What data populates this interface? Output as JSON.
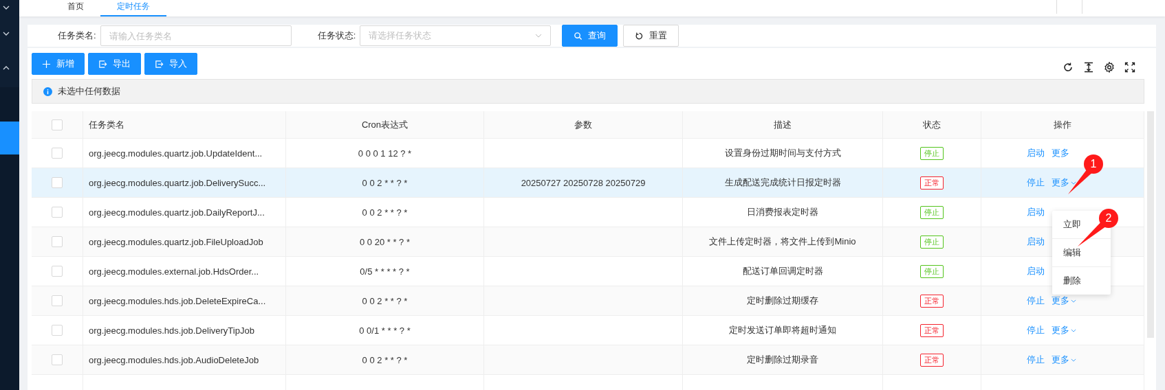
{
  "tabs": [
    {
      "label": "首页",
      "selected": false
    },
    {
      "label": "定时任务",
      "selected": true
    }
  ],
  "search": {
    "fields": [
      {
        "label": "任务类名:",
        "placeholder": "请输入任务类名",
        "kind": "input"
      },
      {
        "label": "任务状态:",
        "placeholder": "请选择任务状态",
        "kind": "select"
      }
    ],
    "buttons": [
      {
        "label": "查询",
        "kind": "primary"
      },
      {
        "label": "重置",
        "kind": "default"
      }
    ]
  },
  "toolbar": {
    "buttons": [
      {
        "label": "新增",
        "kind": "add"
      },
      {
        "label": "导出",
        "kind": "export"
      },
      {
        "label": "导入",
        "kind": "import"
      }
    ]
  },
  "alert": "未选中任何数据",
  "table": {
    "select_all_checked": false,
    "columns": [
      "任务类名",
      "Cron表达式",
      "参数",
      "描述",
      "状态",
      "操作"
    ],
    "rows": [
      {
        "name": "org.jeecg.modules.quartz.job.UpdateIdent...",
        "cron": "0 0 0 1 12 ? *",
        "param": "",
        "desc": "设置身份过期时间与支付方式",
        "status": "停止",
        "color": "#52c41a",
        "action": "启动",
        "more": "更多",
        "more_caret": false,
        "selected": false
      },
      {
        "name": "org.jeecg.modules.quartz.job.DeliverySucc...",
        "cron": "0 0 2 * * ? *",
        "param": "20250727 20250728 20250729",
        "desc": "生成配送完成统计日报定时器",
        "status": "正常",
        "color": "#f5222d",
        "action": "停止",
        "more": "更多",
        "more_caret": true,
        "selected": true
      },
      {
        "name": "org.jeecg.modules.quartz.job.DailyReportJ...",
        "cron": "0 0 2 * * ? *",
        "param": "",
        "desc": "日消费报表定时器",
        "status": "停止",
        "color": "#52c41a",
        "action": "启动",
        "selected": false
      },
      {
        "name": "org.jeecg.modules.quartz.job.FileUploadJob",
        "cron": "0 0 20 * * ? *",
        "param": "",
        "desc": "文件上传定时器，将文件上传到Minio",
        "status": "停止",
        "color": "#52c41a",
        "action": "启动",
        "selected": false
      },
      {
        "name": "org.jeecg.modules.external.job.HdsOrder...",
        "cron": "0/5 * * * * ? *",
        "param": "",
        "desc": "配送订单回调定时器",
        "status": "停止",
        "color": "#52c41a",
        "action": "启动",
        "selected": false
      },
      {
        "name": "org.jeecg.modules.hds.job.DeleteExpireCa...",
        "cron": "0 0 2 * * ? *",
        "param": "",
        "desc": "定时删除过期缓存",
        "status": "正常",
        "color": "#f5222d",
        "action": "停止",
        "more": "更多",
        "more_caret": true,
        "selected": false
      },
      {
        "name": "org.jeecg.modules.hds.job.DeliveryTipJob",
        "cron": "0 0/1 * * * ? *",
        "param": "",
        "desc": "定时发送订单即将超时通知",
        "status": "正常",
        "color": "#f5222d",
        "action": "停止",
        "more": "更多",
        "more_caret": true,
        "selected": false
      },
      {
        "name": "org.jeecg.modules.hds.job.AudioDeleteJob",
        "cron": "0 0 2 * * ? *",
        "param": "",
        "desc": "定时删除过期录音",
        "status": "正常",
        "color": "#f5222d",
        "action": "停止",
        "more": "更多",
        "more_caret": true,
        "selected": false
      }
    ]
  },
  "dropdown": {
    "items": [
      "立即",
      "编辑",
      "删除"
    ]
  },
  "annotations": [
    {
      "label": "1"
    },
    {
      "label": "2"
    }
  ]
}
